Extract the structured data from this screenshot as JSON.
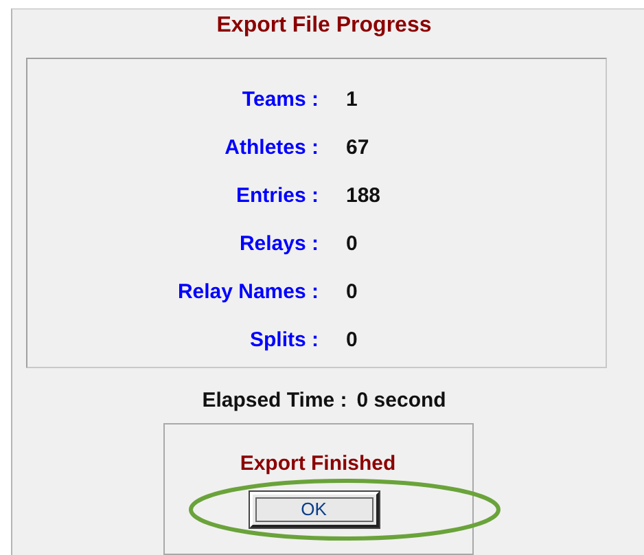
{
  "title": "Export File Progress",
  "stats": [
    {
      "label": "Teams :",
      "value": "1"
    },
    {
      "label": "Athletes :",
      "value": "67"
    },
    {
      "label": "Entries :",
      "value": "188"
    },
    {
      "label": "Relays :",
      "value": "0"
    },
    {
      "label": "Relay Names :",
      "value": "0"
    },
    {
      "label": "Splits :",
      "value": "0"
    }
  ],
  "elapsed": {
    "label": "Elapsed Time :",
    "value": "0 second"
  },
  "status": {
    "message": "Export Finished",
    "button": "OK",
    "highlighted": true
  }
}
